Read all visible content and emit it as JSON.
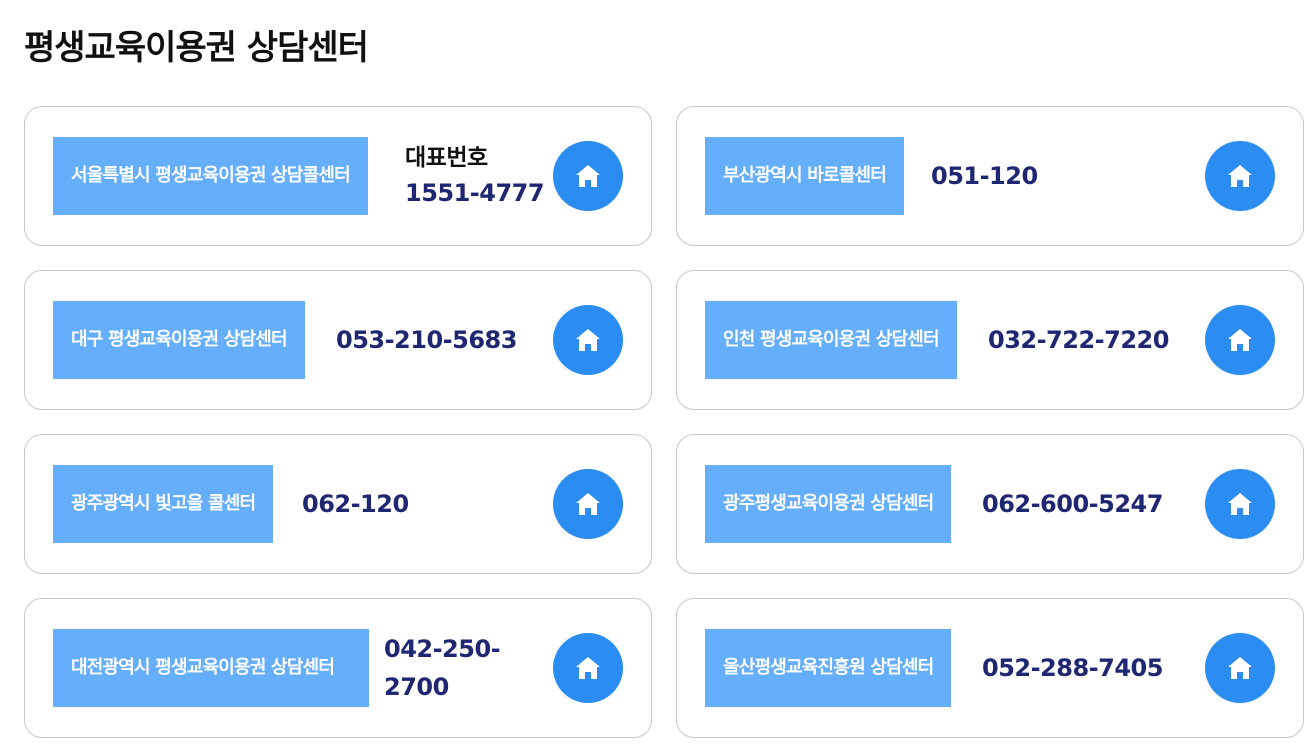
{
  "page": {
    "title": "평생교육이용권 상담센터"
  },
  "centers": [
    {
      "name": "서울특별시 평생교육이용권 상담콜센터",
      "caption": "대표번호",
      "phone": "1551-4777"
    },
    {
      "name": "부산광역시 바로콜센터",
      "phone": "051-120"
    },
    {
      "name": "대구 평생교육이용권 상담센터",
      "phone": "053-210-5683"
    },
    {
      "name": "인천 평생교육이용권 상담센터",
      "phone": "032-722-7220"
    },
    {
      "name": "광주광역시 빛고을 콜센터",
      "phone": "062-120"
    },
    {
      "name": "광주평생교육이용권 상담센터",
      "phone": "062-600-5247"
    },
    {
      "name": "대전광역시 평생교육이용권 상담센터",
      "phone": "042-250-2700"
    },
    {
      "name": "울산평생교육진흥원 상담센터",
      "phone": "052-288-7405"
    }
  ],
  "icons": {
    "home": "home-icon"
  },
  "colors": {
    "label_bg": "#64aefc",
    "phone_text": "#1f2672",
    "home_button_bg": "#2b8df2"
  }
}
